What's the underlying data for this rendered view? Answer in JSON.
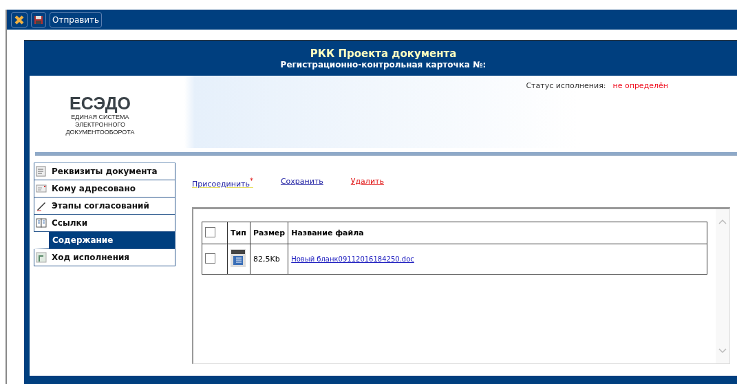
{
  "toolbar": [
    {
      "kind": "close"
    },
    {
      "kind": "save"
    },
    {
      "kind": "text",
      "label": "Отправить"
    }
  ],
  "card": {
    "title": "РКК Проекта документа",
    "subtitle": "Регистрационно-контрольная карточка №:"
  },
  "logo": {
    "name": "ЕСЭДО",
    "tagline": [
      "ЕДИНАЯ СИСТЕМА",
      "ЭЛЕКТРОННОГО",
      "ДОКУМЕНТООБОРОТА"
    ]
  },
  "status": {
    "label": "Статус исполнения:",
    "value": "не определён"
  },
  "sidebar": {
    "items": [
      {
        "label": "Реквизиты документа",
        "kind": "form",
        "selected": false
      },
      {
        "label": "Кому адресовано",
        "kind": "mail",
        "selected": false
      },
      {
        "label": "Этапы согласований",
        "kind": "pen",
        "selected": false
      },
      {
        "label": "Ссылки",
        "kind": "pages",
        "selected": false
      },
      {
        "label": "Содержание",
        "kind": "plain",
        "selected": true
      },
      {
        "label": "Ход исполнения",
        "kind": "flow",
        "selected": false
      }
    ]
  },
  "actions": [
    {
      "label": "Присоединить",
      "kind": "required",
      "marker": "*"
    },
    {
      "label": "Сохранить",
      "kind": "link"
    },
    {
      "label": "Удалить",
      "kind": "danger"
    }
  ],
  "table": {
    "header_checked": false,
    "columns": [
      "Тип",
      "Размер",
      "Название файла"
    ],
    "rows": [
      {
        "checked": false,
        "kind": "doc",
        "size": "82,5Kb",
        "name": "Новый бланк09112016184250.doc"
      }
    ]
  }
}
